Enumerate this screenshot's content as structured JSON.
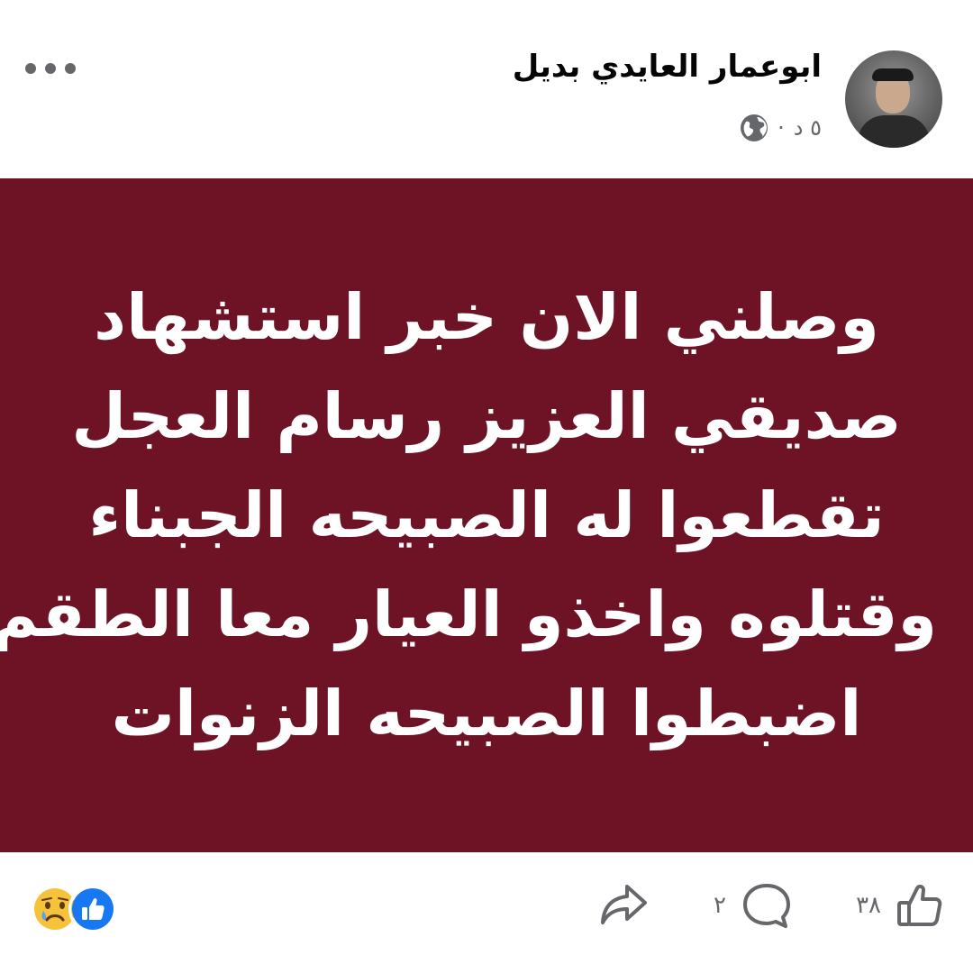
{
  "header": {
    "author_name": "ابوعمار العايدي بديل",
    "time": "٥ د",
    "separator": "·",
    "privacy_icon": "globe-icon",
    "more_icon": "more-horizontal-icon"
  },
  "post": {
    "background_color": "#6e1325",
    "text_color": "#ffffff",
    "lines": [
      "وصلني الان خبر استشهاد",
      "صديقي العزيز رسام العجل",
      "تقطعوا له الصبيحه الجبناء",
      "وقتلوه واخذو العيار معا الطقم",
      "اضبطوا الصبيحه الزنوات"
    ]
  },
  "footer": {
    "reactions": [
      "sad-reaction-icon",
      "like-reaction-icon"
    ],
    "like_count": "٣٨",
    "comment_count": "٢",
    "like_icon": "thumbs-up-icon",
    "comment_icon": "comment-icon",
    "share_icon": "share-icon"
  },
  "colors": {
    "post_background": "#6e1325",
    "secondary_text": "#65676b",
    "like_blue": "#1877f2"
  }
}
